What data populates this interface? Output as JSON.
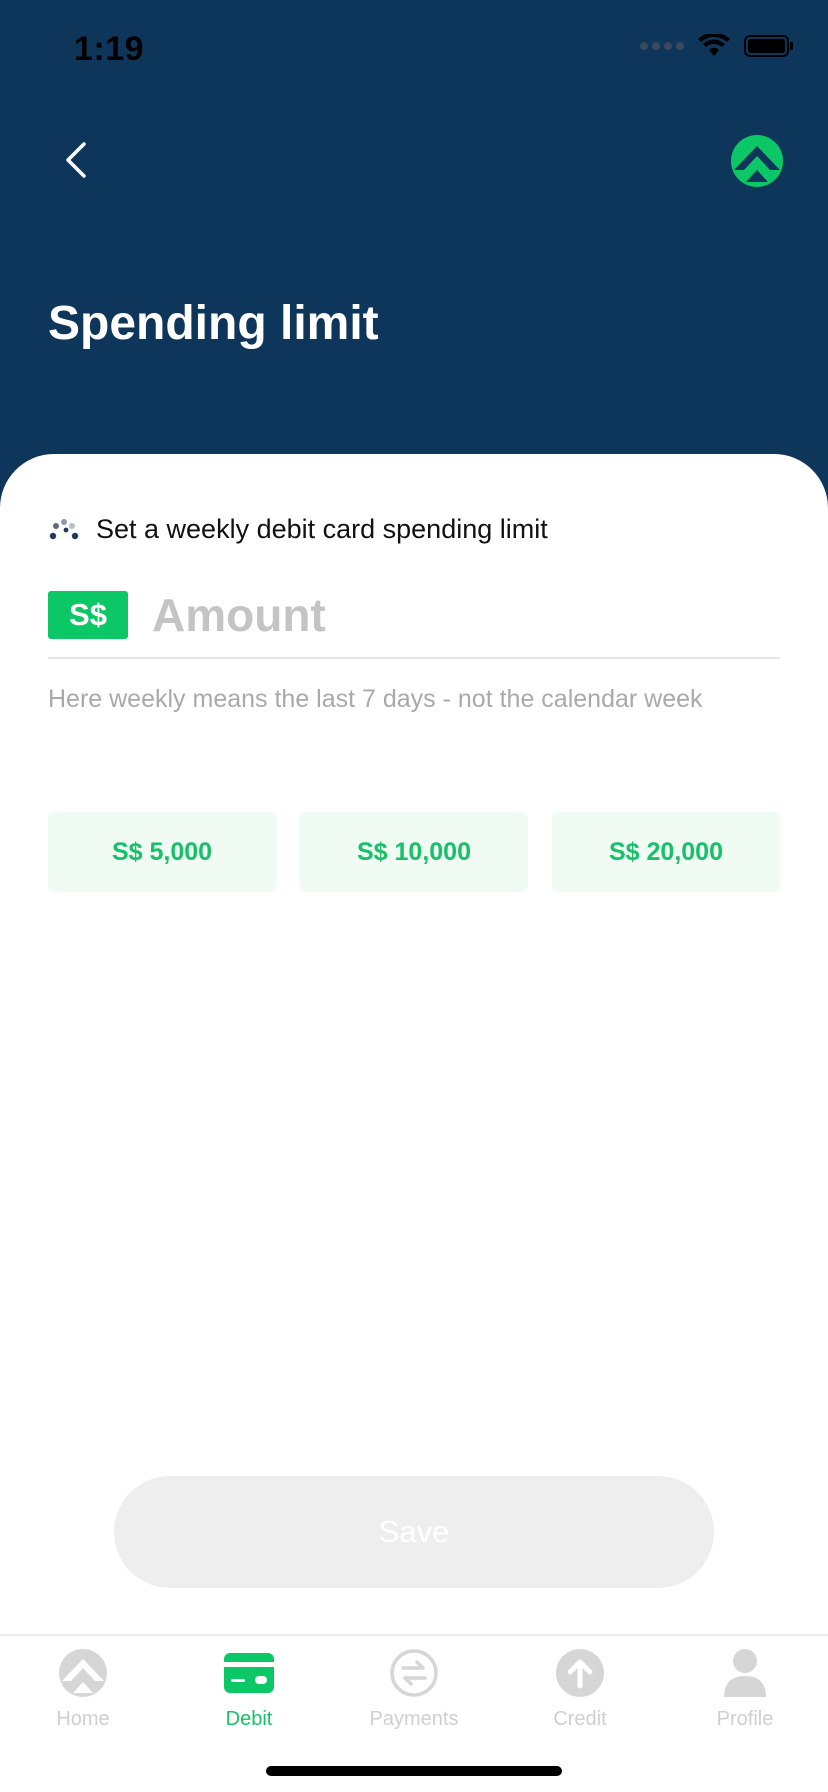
{
  "status_bar": {
    "time": "1:19"
  },
  "header": {
    "title": "Spending limit"
  },
  "form": {
    "limit_label": "Set a weekly debit card spending limit",
    "currency": "S$",
    "amount_placeholder": "Amount",
    "amount_value": "",
    "hint": "Here weekly means the last 7 days - not the calendar week"
  },
  "presets": [
    "S$ 5,000",
    "S$ 10,000",
    "S$ 20,000"
  ],
  "save_label": "Save",
  "tabs": [
    {
      "label": "Home",
      "icon": "home-icon",
      "active": false
    },
    {
      "label": "Debit",
      "icon": "card-icon",
      "active": true
    },
    {
      "label": "Payments",
      "icon": "payments-icon",
      "active": false
    },
    {
      "label": "Credit",
      "icon": "credit-icon",
      "active": false
    },
    {
      "label": "Profile",
      "icon": "profile-icon",
      "active": false
    }
  ],
  "colors": {
    "header_bg": "#0e365b",
    "accent": "#0cc766",
    "preset_bg": "#effbf3",
    "inactive_tab": "#cfcfcf"
  }
}
